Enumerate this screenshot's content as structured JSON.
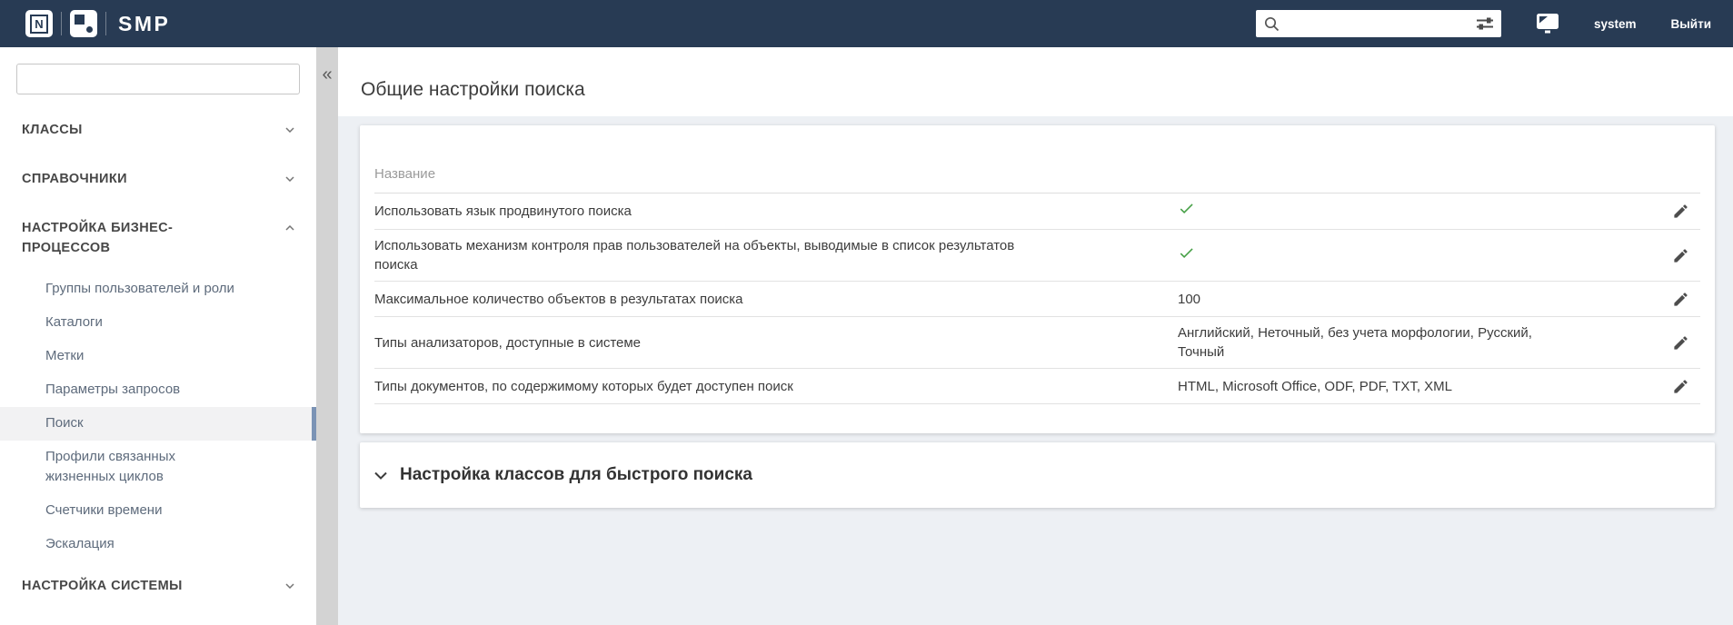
{
  "topbar": {
    "brand": "SMP",
    "logo_letter": "N",
    "search_value": "",
    "user": "system",
    "logout_label": "Выйти"
  },
  "sidebar": {
    "search_value": "",
    "collapse_glyph": "«",
    "sections": [
      {
        "label": "КЛАССЫ",
        "state": "collapsed"
      },
      {
        "label": "СПРАВОЧНИКИ",
        "state": "collapsed"
      },
      {
        "label": "НАСТРОЙКА БИЗНЕС-ПРОЦЕССОВ",
        "state": "expanded",
        "selected": "Поиск",
        "items": [
          "Группы пользователей и роли",
          "Каталоги",
          "Метки",
          "Параметры запросов",
          "Поиск",
          "Профили связанных жизненных циклов",
          "Счетчики времени",
          "Эскалация"
        ]
      },
      {
        "label": "НАСТРОЙКА СИСТЕМЫ",
        "state": "collapsed"
      }
    ]
  },
  "main": {
    "title": "Общие настройки поиска",
    "table": {
      "header": "Название",
      "rows": [
        {
          "label": "Использовать язык продвинутого поиска",
          "checked": true,
          "value": ""
        },
        {
          "label": "Использовать механизм контроля прав пользователей на объекты, выводимые в список результатов поиска",
          "checked": true,
          "value": ""
        },
        {
          "label": "Максимальное количество объектов в результатах поиска",
          "checked": false,
          "value": "100"
        },
        {
          "label": "Типы анализаторов, доступные в системе",
          "checked": false,
          "value": "Английский, Неточный, без учета морфологии, Русский, Точный"
        },
        {
          "label": "Типы документов, по содержимому которых будет доступен поиск",
          "checked": false,
          "value": "HTML, Microsoft Office, ODF, PDF, TXT, XML"
        }
      ]
    },
    "quick_search_section": {
      "title": "Настройка классов для быстрого поиска",
      "state": "expanded"
    }
  },
  "colors": {
    "topbar_bg": "#283b54",
    "check_green": "#46a046",
    "selected_indicator": "#7b93b5",
    "content_bg": "#edf0f4",
    "strip_bg": "#d3d3d3"
  }
}
